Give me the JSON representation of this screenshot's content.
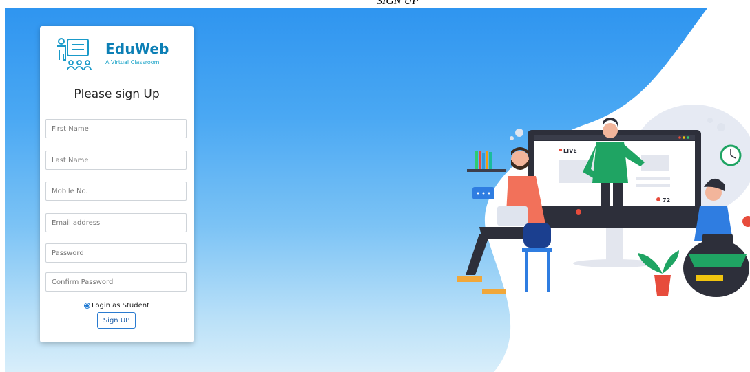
{
  "page": {
    "title": "SIGN UP"
  },
  "brand": {
    "name": "EduWeb",
    "tagline": "A Virtual Classroom"
  },
  "form": {
    "heading": "Please sign Up",
    "fields": [
      {
        "placeholder": "First Name"
      },
      {
        "placeholder": "Last Name"
      },
      {
        "placeholder": "Mobile No."
      },
      {
        "placeholder": "Email address"
      },
      {
        "placeholder": "Password"
      },
      {
        "placeholder": "Confirm Password"
      }
    ],
    "role_option": {
      "label": "Login as Student",
      "selected": true
    },
    "submit_label": "Sign UP"
  },
  "illustration": {
    "live_badge": "LIVE",
    "viewer_count": "72"
  },
  "colors": {
    "brand": "#0c7fb5",
    "bg_blue": "#2f95f0",
    "button_border": "#2a7bd0"
  }
}
